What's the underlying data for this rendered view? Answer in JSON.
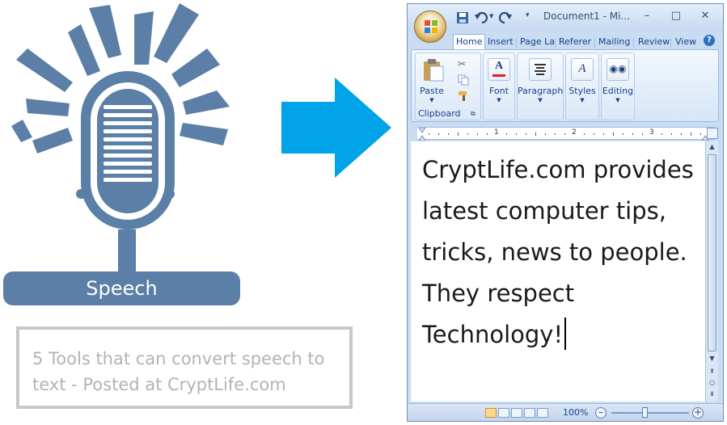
{
  "illustration": {
    "speech_label": "Speech",
    "caption": "5 Tools that can convert speech to text - Posted at CryptLife.com",
    "mic_color": "#5b7fa6",
    "arrow_color": "#00a3e8"
  },
  "word": {
    "window_title": "Document1 - Mi...",
    "window_buttons": {
      "minimize": "–",
      "maximize": "□",
      "close": "✕"
    },
    "tabs": [
      {
        "label": "Home",
        "active": true
      },
      {
        "label": "Insert"
      },
      {
        "label": "Page La"
      },
      {
        "label": "Referer"
      },
      {
        "label": "Mailing"
      },
      {
        "label": "Review"
      },
      {
        "label": "View"
      }
    ],
    "help_glyph": "?",
    "ribbon": {
      "clipboard_group_label": "Clipboard",
      "paste_label": "Paste",
      "font_label": "Font",
      "paragraph_label": "Paragraph",
      "styles_label": "Styles",
      "editing_label": "Editing"
    },
    "ruler_numbers": [
      "1",
      "2",
      "3"
    ],
    "document_text": "CryptLife.com provides\nlatest computer tips,\ntricks, news to people.\nThey respect\nTechnology!",
    "status": {
      "zoom_level": "100%",
      "zoom_out": "–",
      "zoom_in": "+"
    }
  }
}
